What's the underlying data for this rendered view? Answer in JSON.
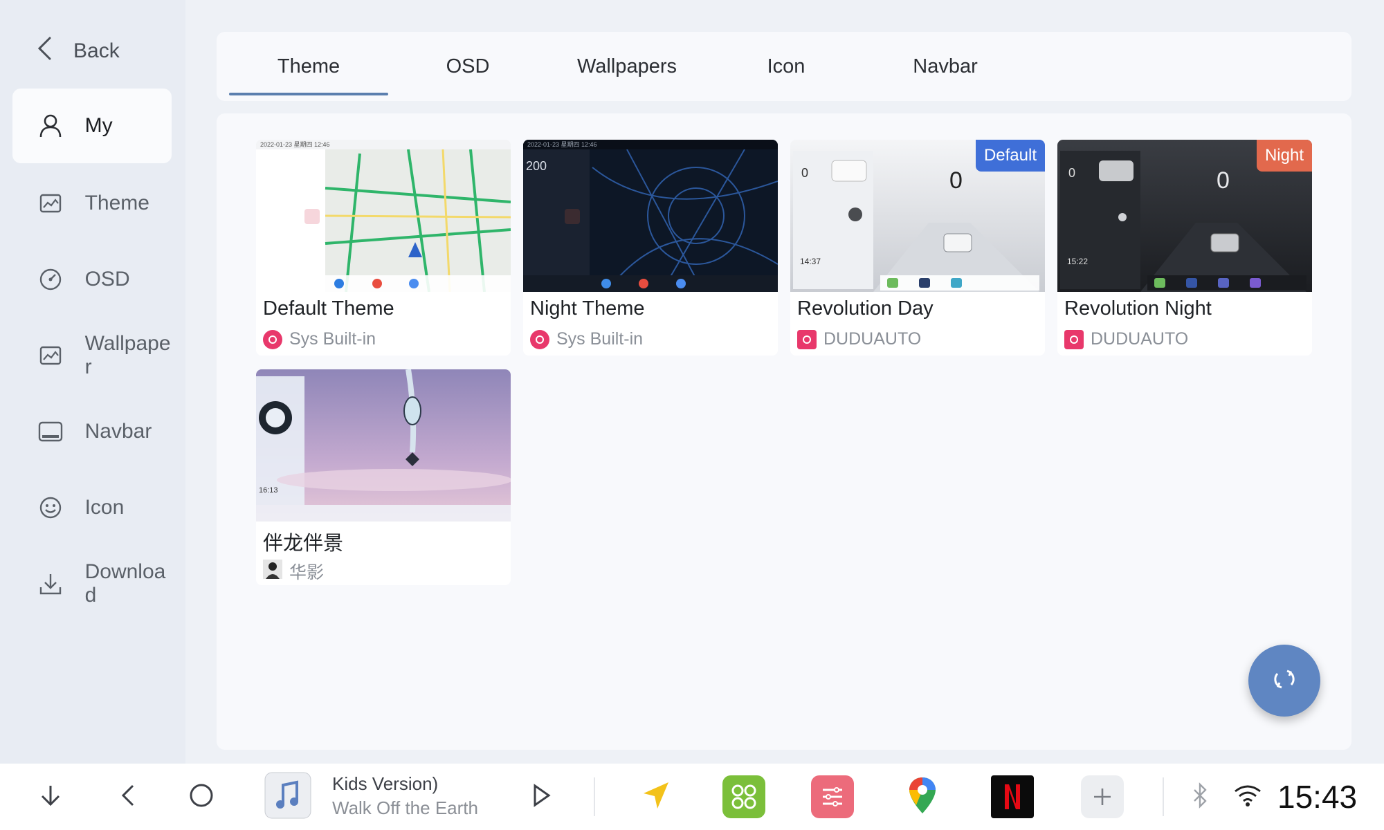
{
  "sidebar": {
    "back_label": "Back",
    "items": [
      {
        "label": "My",
        "icon": "person-icon",
        "active": true
      },
      {
        "label": "Theme",
        "icon": "image-icon"
      },
      {
        "label": "OSD",
        "icon": "gauge-icon"
      },
      {
        "label": "Wallpaper",
        "icon": "image-icon"
      },
      {
        "label": "Navbar",
        "icon": "navbar-icon"
      },
      {
        "label": "Icon",
        "icon": "smiley-icon"
      },
      {
        "label": "Download",
        "icon": "download-icon"
      }
    ]
  },
  "tabs": [
    {
      "label": "Theme",
      "active": true
    },
    {
      "label": "OSD"
    },
    {
      "label": "Wallpapers"
    },
    {
      "label": "Icon"
    },
    {
      "label": "Navbar"
    }
  ],
  "themes": [
    {
      "title": "Default Theme",
      "author": "Sys Built-in"
    },
    {
      "title": "Night Theme",
      "author": "Sys Built-in"
    },
    {
      "title": "Revolution Day",
      "author": "DUDUAUTO",
      "badge": "Default",
      "badge_color": "#3f6fd8"
    },
    {
      "title": "Revolution Night",
      "author": "DUDUAUTO",
      "badge": "Night",
      "badge_color": "#e2694d"
    },
    {
      "title": "伴龙伴景",
      "author": "华影"
    }
  ],
  "thumb_text": {
    "default_date": "2022-01-23  星期四  12:46",
    "night_date": "2022-01-23  星期四  12:46",
    "night_speed": "200",
    "rev_day_speed": "0",
    "rev_day_time": "14:37",
    "rev_night_speed": "0",
    "rev_night_time": "15:22",
    "banlong_time": "16:13"
  },
  "bottombar": {
    "media_line1": "Kids Version)",
    "media_line2": "Walk Off the Earth",
    "time": "15:43"
  },
  "colors": {
    "accent": "#5b7fae",
    "fab": "#5f86c2",
    "brand_logo": "#e8386b"
  }
}
